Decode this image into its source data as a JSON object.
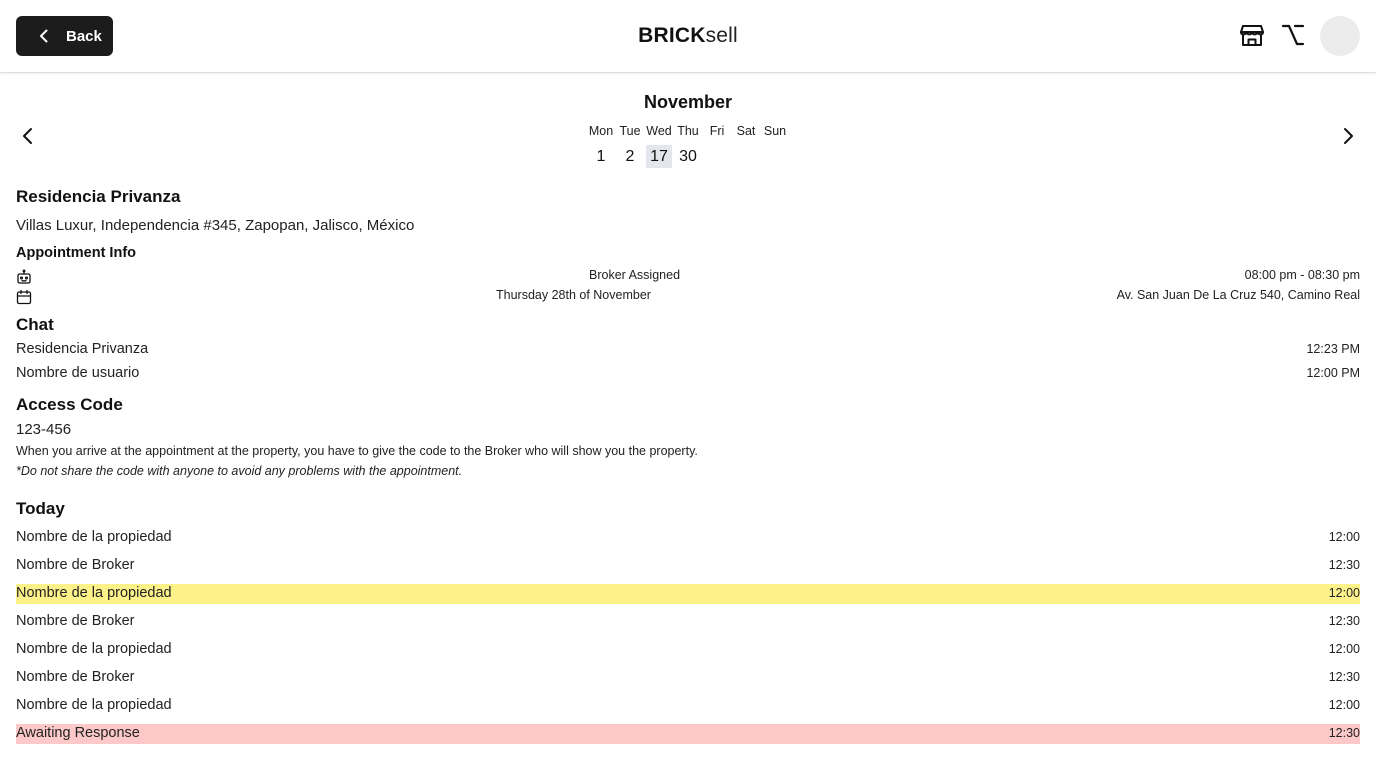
{
  "header": {
    "back_label": "Back",
    "brand_bold": "BRICK",
    "brand_light": "sell"
  },
  "calendar": {
    "month": "November",
    "day_names": [
      "Mon",
      "Tue",
      "Wed",
      "Thu",
      "Fri",
      "Sat",
      "Sun"
    ],
    "days": [
      "1",
      "2",
      "17",
      "30"
    ],
    "selected_day": "17"
  },
  "property": {
    "title": "Residencia Privanza",
    "address": "Villas Luxur, Independencia #345, Zapopan, Jalisco, México"
  },
  "appointment": {
    "heading": "Appointment Info",
    "broker_status": "Broker Assigned",
    "time_range": "08:00 pm - 08:30 pm",
    "date": "Thursday 28th of November",
    "location": "Av. San Juan De La Cruz 540, Camino Real"
  },
  "chat": {
    "heading": "Chat",
    "items": [
      {
        "name": "Residencia Privanza",
        "time": "12:23 PM"
      },
      {
        "name": "Nombre de usuario",
        "time": "12:00 PM"
      }
    ]
  },
  "access": {
    "heading": "Access Code",
    "code": "123-456",
    "note": "When you arrive at the appointment at the property, you have to give the code to the Broker who will show you the property.",
    "warning": "*Do not share the code with anyone to avoid any problems with the appointment."
  },
  "today": {
    "heading": "Today",
    "items": [
      {
        "name": "Nombre de la propiedad",
        "time": "12:00",
        "highlight": ""
      },
      {
        "name": "Nombre de Broker",
        "time": "12:30",
        "highlight": ""
      },
      {
        "name": "Nombre de la propiedad",
        "time": "12:00",
        "highlight": "yellow"
      },
      {
        "name": "Nombre de Broker",
        "time": "12:30",
        "highlight": ""
      },
      {
        "name": "Nombre de la propiedad",
        "time": "12:00",
        "highlight": ""
      },
      {
        "name": "Nombre de Broker",
        "time": "12:30",
        "highlight": ""
      },
      {
        "name": "Nombre de la propiedad",
        "time": "12:00",
        "highlight": ""
      },
      {
        "name": "Awaiting Response",
        "time": "12:30",
        "highlight": "red"
      }
    ]
  },
  "colors": {
    "highlight_yellow": "#fdf18a",
    "highlight_red": "#fdc8c8",
    "selected_day_bg": "#e3e6ec",
    "back_button_bg": "#1c1c1c"
  }
}
